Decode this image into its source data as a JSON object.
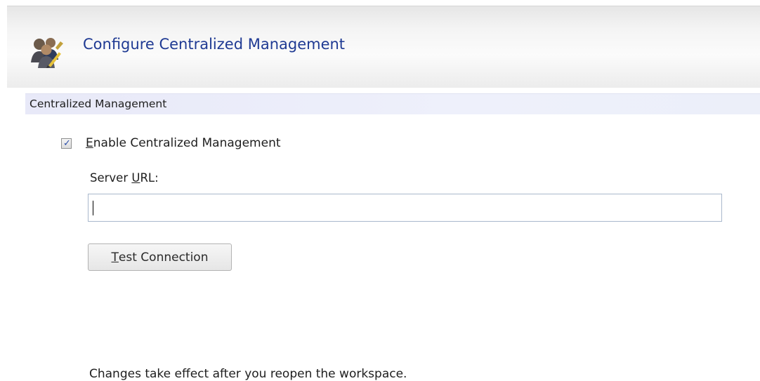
{
  "header": {
    "title": "Configure Centralized Management",
    "icon": "users-edit-icon"
  },
  "section": {
    "title": "Centralized Management"
  },
  "enable_checkbox": {
    "checked": true,
    "label_mnemonic": "E",
    "label_rest": "nable Centralized Management"
  },
  "server_url": {
    "label_prefix": "Server ",
    "label_mnemonic": "U",
    "label_suffix": "RL:",
    "value": ""
  },
  "test_button": {
    "label_mnemonic": "T",
    "label_rest": "est Connection"
  },
  "footer_note": "Changes take effect after you reopen the workspace.",
  "colors": {
    "title_blue": "#1f3a93",
    "section_bar": "#e8e9f8",
    "checkmark": "#2b4ea8"
  }
}
